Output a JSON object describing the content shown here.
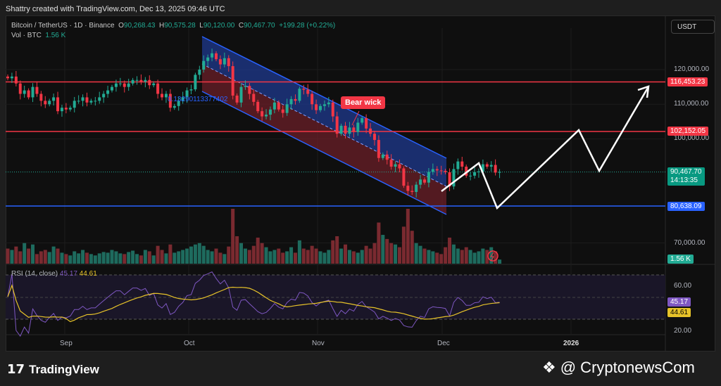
{
  "credit": "Shattry created with TradingView.com, Dec 13, 2025 09:46 UTC",
  "legend": {
    "symbol": "Bitcoin / TetherUS · 1D · Binance",
    "o_label": "O",
    "o": "90,268.43",
    "h_label": "H",
    "h": "90,575.28",
    "l_label": "L",
    "l": "90,120.00",
    "c_label": "C",
    "c": "90,467.70",
    "change": "+199.28 (+0.22%)",
    "vol_label": "Vol · BTC",
    "vol": "1.56 K"
  },
  "currency": "USDT",
  "price_ticks": [
    "120,000.00",
    "110,000.00",
    "100,000.00",
    "70,000.00"
  ],
  "price_tags": {
    "resistance_high": "116,453.23",
    "resistance_mid": "102,152.05",
    "current": "90,467.70",
    "countdown": "14:13:35",
    "support": "80,638.09",
    "volume": "1.56 K"
  },
  "rsi": {
    "label": "RSI (14, close)",
    "value": "45.17",
    "ma": "44.61",
    "ticks": [
      "60.00",
      "20.00"
    ]
  },
  "time_labels": [
    "Sep",
    "Oct",
    "Nov",
    "Dec",
    "2026"
  ],
  "annotations": {
    "bear_wick": "Bear wick",
    "fib_level": "0.13290113377402"
  },
  "branding": {
    "logo": "TradingView",
    "watermark": "@ CryptonewsCom"
  },
  "colors": {
    "up": "#22ab94",
    "down": "#f23645",
    "resistance": "#f23645",
    "support": "#2962ff",
    "rsi": "#7e57c2",
    "rsi_ma": "#e6c229"
  },
  "levels": {
    "resistance_high": 116453.23,
    "resistance_mid": 102152.05,
    "support": 80638.09,
    "current": 90467.7
  },
  "closes": [
    117.5,
    118,
    116,
    113,
    114,
    112,
    115,
    113,
    111,
    110,
    111,
    112,
    108,
    109,
    108.5,
    109,
    111,
    111,
    112,
    110.5,
    111,
    111,
    112,
    113,
    114,
    115,
    116,
    116,
    115,
    116,
    117,
    117,
    116.5,
    117,
    115.5,
    116,
    113,
    112,
    113,
    109,
    109.5,
    111,
    112,
    114,
    114.3,
    118.5,
    120,
    122.5,
    123.5,
    124.7,
    123,
    121.5,
    123.3,
    121,
    112.5,
    110.5,
    115,
    115.3,
    113,
    110.7,
    108,
    106.5,
    107,
    108.5,
    110.5,
    108.5,
    107.5,
    110,
    111.5,
    111,
    114.5,
    114.2,
    113,
    110,
    108.3,
    109.5,
    110,
    110.5,
    106.5,
    101.5,
    103.8,
    101.5,
    103.3,
    102,
    104.7,
    106,
    103,
    101.5,
    99.7,
    94.5,
    95.5,
    94,
    92,
    92.7,
    91.5,
    86.5,
    85,
    84.7,
    86.8,
    88.3,
    87.4,
    90.5,
    91.3,
    90.9,
    90.8,
    90.4,
    86.3,
    91.3,
    93.5,
    92,
    89.4,
    89.4,
    90.4,
    90.6,
    92.7,
    92,
    92.5,
    90.3,
    90.47
  ],
  "volumes": [
    22,
    20,
    25,
    18,
    30,
    22,
    28,
    14,
    18,
    20,
    17,
    25,
    22,
    16,
    14,
    12,
    18,
    15,
    20,
    16,
    14,
    12,
    15,
    17,
    16,
    20,
    18,
    15,
    14,
    17,
    19,
    14,
    12,
    20,
    18,
    12,
    26,
    20,
    15,
    28,
    16,
    18,
    20,
    22,
    25,
    28,
    30,
    26,
    20,
    18,
    22,
    16,
    14,
    25,
    80,
    40,
    30,
    22,
    20,
    26,
    38,
    30,
    24,
    18,
    20,
    22,
    16,
    18,
    24,
    16,
    34,
    22,
    20,
    26,
    22,
    18,
    16,
    20,
    34,
    40,
    22,
    28,
    20,
    18,
    16,
    20,
    26,
    22,
    30,
    60,
    42,
    36,
    30,
    28,
    24,
    54,
    80,
    48,
    30,
    26,
    22,
    20,
    18,
    16,
    14,
    24,
    38,
    28,
    22,
    20,
    24,
    20,
    16,
    18,
    22,
    20,
    24,
    18,
    6
  ]
}
